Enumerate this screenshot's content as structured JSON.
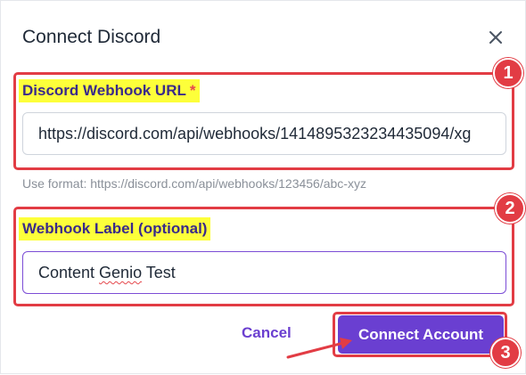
{
  "dialog": {
    "title": "Connect Discord",
    "close_icon": "close-icon"
  },
  "webhook_url": {
    "label": "Discord Webhook URL",
    "required_mark": "*",
    "value": "https://discord.com/api/webhooks/1414895323234435094/xg",
    "hint": "Use format: https://discord.com/api/webhooks/123456/abc-xyz"
  },
  "webhook_label": {
    "label": "Webhook Label (optional)",
    "value_prefix": "Content ",
    "value_misspelled": "Genio",
    "value_suffix": " Test"
  },
  "actions": {
    "cancel_label": "Cancel",
    "connect_label": "Connect Account"
  },
  "annotations": {
    "badge_1": "1",
    "badge_2": "2",
    "badge_3": "3",
    "color": "#e23c44"
  },
  "colors": {
    "accent": "#6a3fd1",
    "highlight": "#fdff3a",
    "annotation": "#e23c44"
  }
}
